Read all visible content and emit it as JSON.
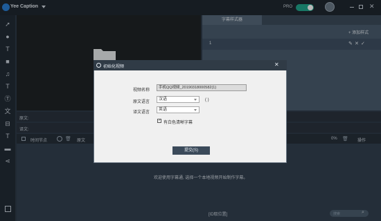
{
  "app": {
    "title": "Yee Caption",
    "pro_label": "PRO"
  },
  "right_panel": {
    "tab": "字幕样式器",
    "add_style": "添加样式",
    "row_number": "1"
  },
  "editor": {
    "original_label": "原文:",
    "translation_label": "译文:"
  },
  "table": {
    "time_header": "时间节点",
    "original_header": "原文",
    "percent": "0%",
    "action_header": "操作"
  },
  "main": {
    "welcome": "欢迎使用字幕通, 选择一个本地视频开始制作字幕。",
    "bottom_label": "[ID取位置]",
    "search_placeholder": "搜索"
  },
  "dialog": {
    "title": "初始化视频",
    "name_label": "视频名称",
    "name_value": "手机QQ视频_20190318000582(1)",
    "source_label": "原文语言",
    "source_value": "汉语",
    "source_hint": "( )",
    "target_label": "译文语言",
    "target_value": "英语",
    "checkbox_label": "有白色清晰字幕",
    "checkbox_checked": true,
    "submit_label": "提交(S)"
  },
  "colors": {
    "accent": "#22a58c",
    "topbar": "#1f2730",
    "panel": "#4a5c6e"
  }
}
